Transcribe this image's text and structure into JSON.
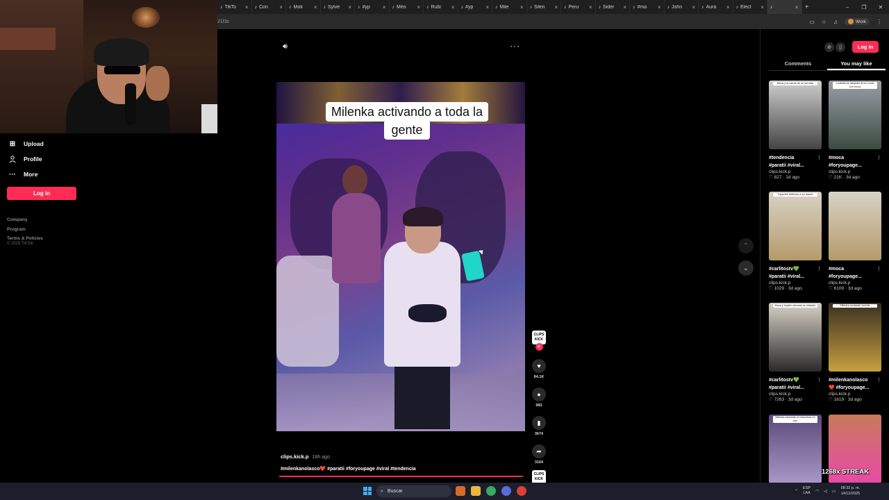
{
  "browser": {
    "tabs": [
      {
        "title": "TikTo"
      },
      {
        "title": "Con"
      },
      {
        "title": "Moti"
      },
      {
        "title": "Sylve"
      },
      {
        "title": "#yp"
      },
      {
        "title": "Mèo"
      },
      {
        "title": "Rubi"
      },
      {
        "title": "#yp"
      },
      {
        "title": "Mile"
      },
      {
        "title": "Silen"
      },
      {
        "title": "Peru"
      },
      {
        "title": "Sider"
      },
      {
        "title": "#ma"
      },
      {
        "title": "John"
      },
      {
        "title": "Aura"
      },
      {
        "title": "Elect"
      },
      {
        "title": ""
      }
    ],
    "new_tab": "+",
    "address_fragment": "21f3c",
    "profile_label": "Work"
  },
  "sidebar": {
    "items": [
      {
        "label": "Upload",
        "icon": "upload-icon"
      },
      {
        "label": "Profile",
        "icon": "profile-icon"
      },
      {
        "label": "More",
        "icon": "more-icon"
      }
    ],
    "login_label": "Log in",
    "footer_links": [
      "Company",
      "Program",
      "Terms & Policies"
    ],
    "copyright": "© 2025 TikTok"
  },
  "video": {
    "caption_line1": "Milenka activando a toda la",
    "caption_line2": "gente",
    "author": "clips.kick.p",
    "time": "18h ago",
    "description_parts": [
      "#milenkanolasco",
      "❤️",
      " #paratii #foryoupage #viral #tendencia"
    ],
    "progress": 0.995
  },
  "actions": {
    "avatar_text": "CLIPS KICK",
    "likes": "84.1K",
    "comments": "983",
    "saves": "3674",
    "shares": "3164",
    "music_text": "CLIPS KICK"
  },
  "right_panel": {
    "login_label": "Log in",
    "tabs": [
      "Comments",
      "You may like"
    ],
    "active_tab": 1,
    "cards": [
      {
        "caption": "Moca y el carnal de un sol más",
        "title1": "#tendencia",
        "title2": "#paratii #viral...",
        "author": "clips.kick.p",
        "likes": "827",
        "age": "1d ago",
        "palette": [
          "#cfcfcf",
          "#444"
        ]
      },
      {
        "caption": "Loribella se despidió de su novio con moca",
        "title1": "#moca",
        "title2": "#foryoupage...",
        "author": "clips.kick.p",
        "likes": "21K",
        "age": "3d ago",
        "palette": [
          "#9aa0a6",
          "#3a4a40"
        ]
      },
      {
        "caption": "Taylorbin defiendo a su mama",
        "title1": "#carlitostv💚",
        "title2": "#paratii #viral...",
        "author": "clips.kick.p",
        "likes": "1029",
        "age": "3d ago",
        "palette": [
          "#d8d2c8",
          "#b59a6a"
        ]
      },
      {
        "caption": "",
        "title1": "#moca",
        "title2": "#foryoupage...",
        "author": "clips.kick.p",
        "likes": "6109",
        "age": "3d ago",
        "palette": [
          "#d8d2c8",
          "#b59a6a"
        ]
      },
      {
        "caption": "Moca y hoybin retoman su relación",
        "title1": "#carlitostv💚",
        "title2": "#paratii #viral...",
        "author": "clips.kick.p",
        "likes": "7263",
        "age": "3d ago",
        "palette": [
          "#d8d2c8",
          "#2a2a2a"
        ]
      },
      {
        "caption": "Milenka cantando cumbia",
        "title1": "#milenkanolasco",
        "title2": "❤️ #foryoupage...",
        "author": "clips.kick.p",
        "likes": "1619",
        "age": "3d ago",
        "palette": [
          "#3a3020",
          "#c8a040"
        ]
      },
      {
        "caption": "Milenka cantando no escuchas en vivo",
        "title1": "",
        "title2": "",
        "author": "",
        "likes": "",
        "age": "",
        "palette": [
          "#5a4a7a",
          "#a898c8"
        ]
      },
      {
        "caption": "",
        "title1": "",
        "title2": "",
        "author": "",
        "likes": "",
        "age": "",
        "palette": [
          "#c87a5a",
          "#e84aa8"
        ]
      }
    ],
    "streak_text": "1268x STREAK"
  },
  "taskbar": {
    "search_placeholder": "Buscar",
    "lang1": "ESP",
    "lang2": "LAA",
    "time": "08:32 p. m.",
    "date": "14/12/2025"
  },
  "colors": {
    "accent": "#fe2c55",
    "background": "#000000"
  }
}
